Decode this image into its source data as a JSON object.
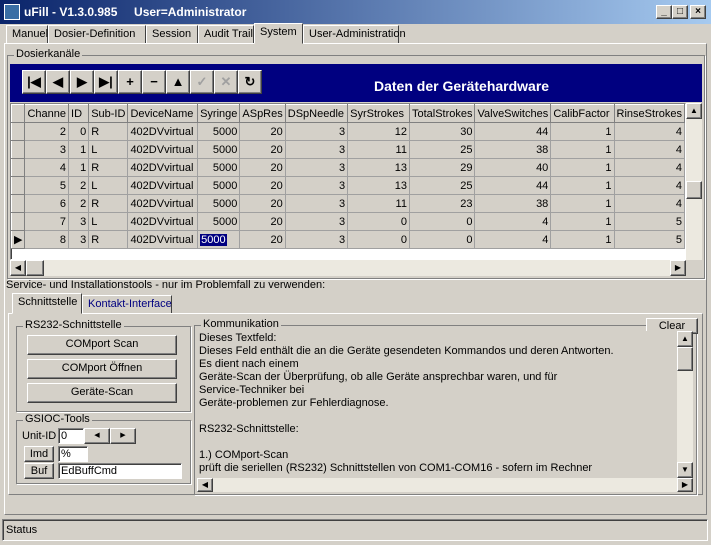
{
  "window": {
    "title": "uFill - V1.3.0.985     User=Administrator"
  },
  "tabs": [
    "Manuell",
    "Dosier-Definition",
    "Session",
    "Audit Trail",
    "System",
    "User-Administration"
  ],
  "active_tab": "System",
  "dosier": {
    "group_label": "Dosierkanäle",
    "nav_title": "Daten der Gerätehardware",
    "nav_icons": [
      "first-icon",
      "prior-icon",
      "next-icon",
      "last-icon",
      "insert-icon",
      "delete-icon",
      "edit-icon",
      "post-icon",
      "cancel-icon",
      "refresh-icon"
    ],
    "columns": [
      "Channe",
      "ID",
      "Sub-ID",
      "DeviceName",
      "Syringe",
      "ASpRes",
      "DSpNeedle",
      "SyrStrokes",
      "TotalStrokes",
      "ValveSwitches",
      "CalibFactor",
      "RinseStrokes"
    ],
    "rows": [
      [
        "2",
        "0",
        "R",
        "402DVvirtual",
        "5000",
        "20",
        "3",
        "12",
        "30",
        "44",
        "1",
        "4"
      ],
      [
        "3",
        "1",
        "L",
        "402DVvirtual",
        "5000",
        "20",
        "3",
        "11",
        "25",
        "38",
        "1",
        "4"
      ],
      [
        "4",
        "1",
        "R",
        "402DVvirtual",
        "5000",
        "20",
        "3",
        "13",
        "29",
        "40",
        "1",
        "4"
      ],
      [
        "5",
        "2",
        "L",
        "402DVvirtual",
        "5000",
        "20",
        "3",
        "13",
        "25",
        "44",
        "1",
        "4"
      ],
      [
        "6",
        "2",
        "R",
        "402DVvirtual",
        "5000",
        "20",
        "3",
        "11",
        "23",
        "38",
        "1",
        "4"
      ],
      [
        "7",
        "3",
        "L",
        "402DVvirtual",
        "5000",
        "20",
        "3",
        "0",
        "0",
        "4",
        "1",
        "5"
      ],
      [
        "8",
        "3",
        "R",
        "402DVvirtual",
        "5000",
        "20",
        "3",
        "0",
        "0",
        "4",
        "1",
        "5"
      ]
    ],
    "current_row_index": 6
  },
  "service": {
    "label": "Service- und Installationstools - nur im Problemfall zu verwenden:",
    "tabs": [
      "Schnittstelle",
      "Kontakt-Interface"
    ],
    "active_tab": "Schnittstelle",
    "rs232": {
      "label": "RS232-Schnittstelle",
      "buttons": [
        "COMport Scan",
        "COMport Öffnen",
        "Geräte-Scan"
      ]
    },
    "gsioc": {
      "label": "GSIOC-Tools",
      "unit_id_label": "Unit-ID",
      "unit_id_value": "0",
      "imd_label": "Imd",
      "imd_value": "%",
      "buf_label": "Buf",
      "buf_value": "EdBuffCmd"
    },
    "kommunikation": {
      "label": "Kommunikation",
      "clear_label": "Clear",
      "text": "Dieses Textfeld:\nDieses Feld enthält die an die Geräte gesendeten Kommandos und deren Antworten.\nEs dient nach einem\nGeräte-Scan der Überprüfung, ob alle Geräte ansprechbar waren, und für\nService-Techniker bei\nGeräte-problemen zur Fehlerdiagnose.\n\nRS232-Schnittstelle:\n\n1.) COMport-Scan\nprüft die seriellen (RS232) Schnittstellen von COM1-COM16 - sofern im Rechner"
    }
  },
  "status": {
    "text": "Status"
  }
}
